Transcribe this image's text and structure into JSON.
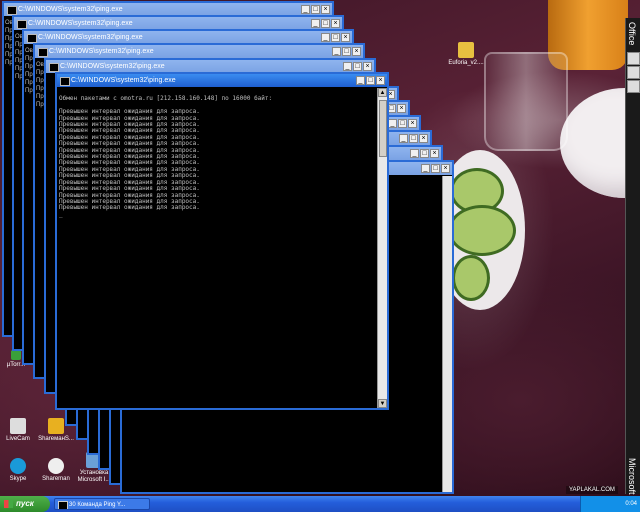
{
  "window_title": "C:\\WINDOWS\\system32\\ping.exe",
  "console": {
    "header": "Обмен пакетами с omotra.ru [212.158.160.148] по 16000 байт:",
    "timeout_line": "Превышен интервал ожидания для запроса.",
    "timeout_count": 16,
    "cursor": "_"
  },
  "background_edge_text": [
    "Ов",
    "Пр",
    "Пр",
    "Пр",
    "Пр",
    "Пр",
    "Пр",
    "Пр",
    "Пр"
  ],
  "desktop_icons": [
    {
      "label": "Euforia_v2....",
      "icon": "folder-icon",
      "color": "#e8c040"
    },
    {
      "label": "µTorr...",
      "icon": "utorrent-icon",
      "color": "#3aa03a"
    },
    {
      "label": "LiveCam",
      "icon": "livecam-icon",
      "color": "#dddddd"
    },
    {
      "label": "ShareманS...",
      "icon": "shareman-icon",
      "color": "#e8b020"
    },
    {
      "label": "Skype",
      "icon": "skype-icon",
      "color": "#1a9ad8"
    },
    {
      "label": "Shareman",
      "icon": "shareman-ghost-icon",
      "color": "#eeeeee"
    },
    {
      "label": "Установка Microsoft I...",
      "icon": "installer-icon",
      "color": "#6aa0d8"
    }
  ],
  "sidebar": {
    "top_label": "Office",
    "bottom_label": "Microsoft"
  },
  "taskbar": {
    "start_label": "пуск",
    "task_label": "30 Команда Ping Y...",
    "clock": "0:04"
  },
  "watermark": "YAPLAKAL.COM",
  "colors": {
    "titlebar_active": "#1f5fd0",
    "taskbar": "#245edb",
    "start": "#2d8a2a"
  }
}
